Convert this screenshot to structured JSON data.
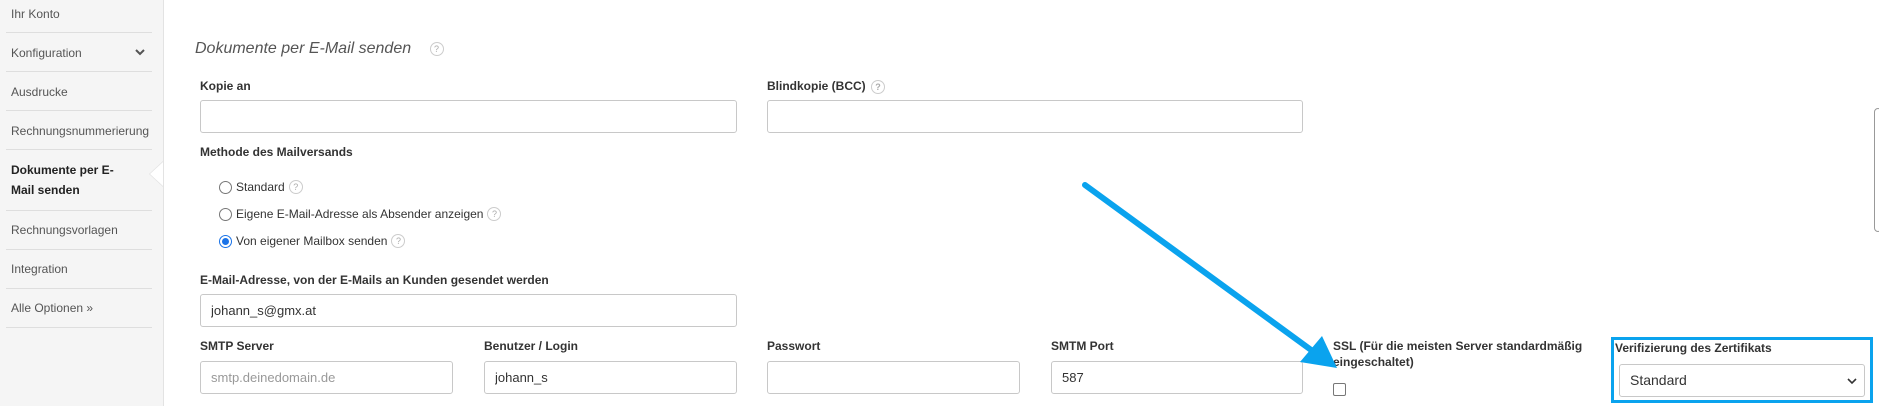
{
  "sidebar": {
    "items": [
      {
        "label": "Ihr Konto"
      },
      {
        "label": "Konfiguration"
      },
      {
        "label": "Ausdrucke"
      },
      {
        "label": "Rechnungsnummerierung"
      },
      {
        "label": "Dokumente per E-Mail senden",
        "line1": "Dokumente per E-",
        "line2": "Mail senden"
      },
      {
        "label": "Rechnungsvorlagen"
      },
      {
        "label": "Integration"
      },
      {
        "label": "Alle Optionen »"
      }
    ]
  },
  "main": {
    "title": "Dokumente per E-Mail senden",
    "help_glyph": "?",
    "kopie_an": {
      "label": "Kopie an",
      "value": ""
    },
    "bcc": {
      "label": "Blindkopie (BCC)",
      "value": ""
    },
    "methode": {
      "label": "Methode des Mailversands",
      "options": [
        {
          "label": "Standard",
          "selected": false
        },
        {
          "label": "Eigene E-Mail-Adresse als Absender anzeigen",
          "selected": false
        },
        {
          "label": "Von eigener Mailbox senden",
          "selected": true
        }
      ]
    },
    "email": {
      "label": "E-Mail-Adresse, von der E-Mails an Kunden gesendet werden",
      "value": "johann_s@gmx.at"
    },
    "smtp_server": {
      "label": "SMTP Server",
      "value": "",
      "placeholder": "smtp.deinedomain.de"
    },
    "benutzer": {
      "label": "Benutzer / Login",
      "value": "johann_s"
    },
    "passwort": {
      "label": "Passwort",
      "value": ""
    },
    "smtp_port": {
      "label": "SMTM Port",
      "value": "587"
    },
    "ssl": {
      "label_line1": "SSL (Für die meisten Server standardmäßig",
      "label_line2": "eingeschaltet)",
      "checked": false
    },
    "verifizierung": {
      "label": "Verifizierung des Zertifikats",
      "selected": "Standard"
    }
  },
  "colors": {
    "annotation": "#0aa3ee",
    "radio_selected": "#1a73e8"
  }
}
